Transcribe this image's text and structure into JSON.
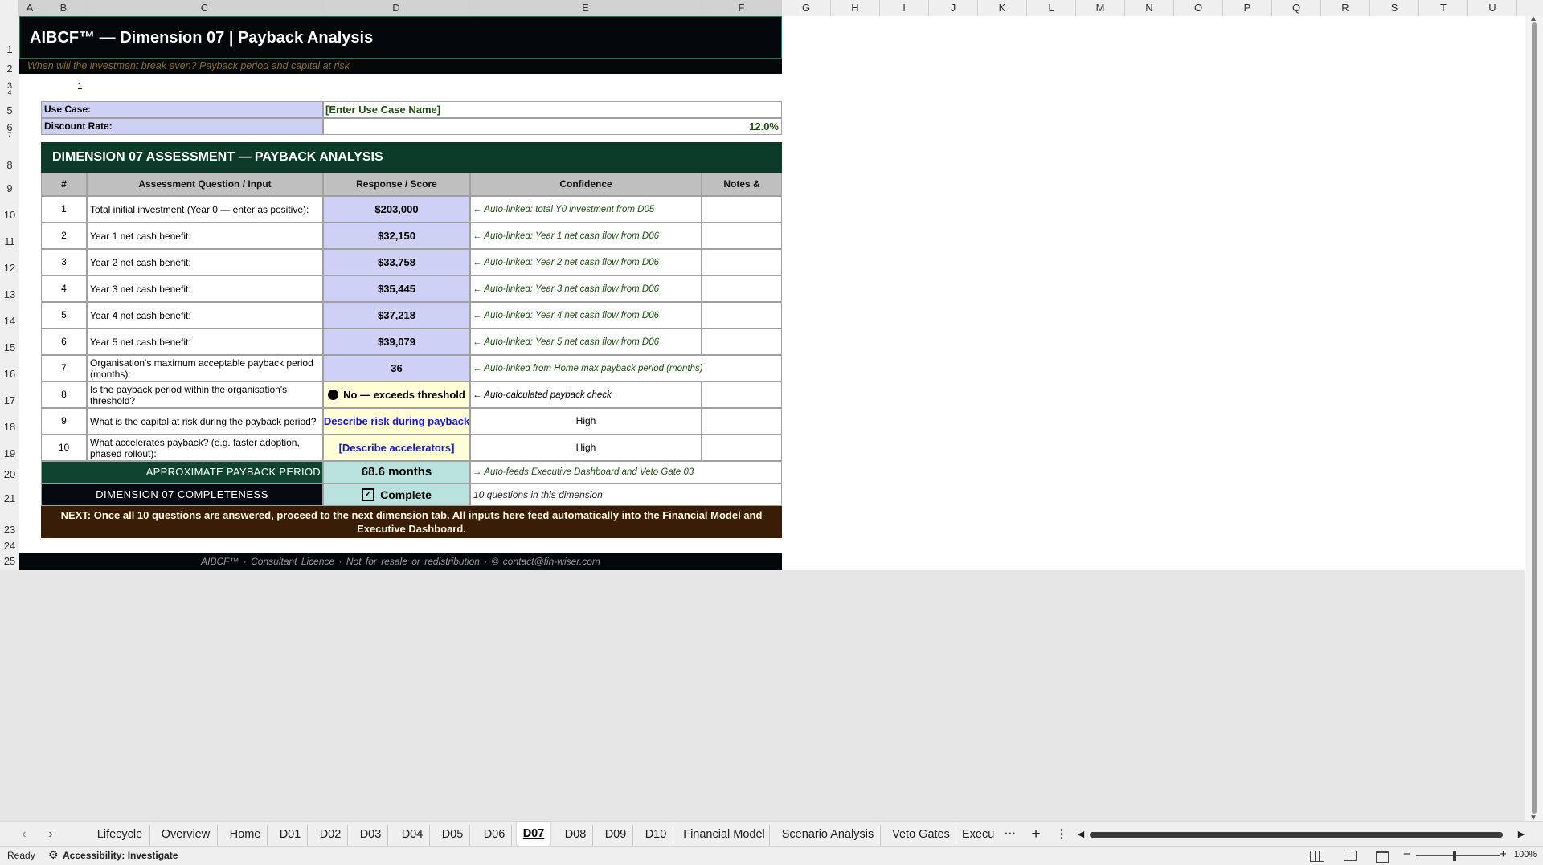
{
  "columns": [
    "A",
    "B",
    "C",
    "D",
    "E",
    "F",
    "G",
    "H",
    "I",
    "J",
    "K",
    "L",
    "M",
    "N",
    "O",
    "P",
    "Q",
    "R",
    "S",
    "T",
    "U"
  ],
  "rows": [
    "1",
    "2",
    "3",
    "4",
    "5",
    "6",
    "7",
    "8",
    "9",
    "10",
    "11",
    "12",
    "13",
    "14",
    "15",
    "16",
    "17",
    "18",
    "19",
    "20",
    "21",
    "23",
    "24",
    "25"
  ],
  "sheet": {
    "title": "AIBCF™ — Dimension 07 | Payback Analysis",
    "subtitle": "When will the investment break even? Payback period and capital at risk",
    "row3_value": "1",
    "use_case_label": "Use Case:",
    "use_case_value": "[Enter Use Case Name]",
    "discount_label": "Discount Rate:",
    "discount_value": "12.0%",
    "section_title": "DIMENSION 07 ASSESSMENT — PAYBACK ANALYSIS",
    "table_headers": [
      "#",
      "Assessment Question / Input",
      "Response / Score",
      "Confidence",
      "Notes & Evidence"
    ],
    "questions": [
      {
        "n": "1",
        "q": "Total initial investment (Year 0 — enter as positive):",
        "r": "$203,000",
        "c": "← Auto-linked: total Y0 investment from D05"
      },
      {
        "n": "2",
        "q": "Year 1 net cash benefit:",
        "r": "$32,150",
        "c": "← Auto-linked: Year 1 net cash flow from D06"
      },
      {
        "n": "3",
        "q": "Year 2 net cash benefit:",
        "r": "$33,758",
        "c": "← Auto-linked: Year 2 net cash flow from D06"
      },
      {
        "n": "4",
        "q": "Year 3 net cash benefit:",
        "r": "$35,445",
        "c": "← Auto-linked: Year 3 net cash flow from D06"
      },
      {
        "n": "5",
        "q": "Year 4 net cash benefit:",
        "r": "$37,218",
        "c": "← Auto-linked: Year 4 net cash flow from D06"
      },
      {
        "n": "6",
        "q": "Year 5 net cash benefit:",
        "r": "$39,079",
        "c": "← Auto-linked: Year 5 net cash flow from D06"
      },
      {
        "n": "7",
        "q": "Organisation's maximum acceptable payback period (months):",
        "r": "36",
        "c": "← Auto-linked from Home max payback period (months)"
      },
      {
        "n": "8",
        "q": "Is the payback period within the organisation's threshold?",
        "r": "No — exceeds threshold",
        "c": "← Auto-calculated payback check"
      },
      {
        "n": "9",
        "q": "What is the capital at risk during the payback period?",
        "r": "Describe risk during payback",
        "c": "High"
      },
      {
        "n": "10",
        "q": "What accelerates payback? (e.g. faster adoption, phased rollout):",
        "r": "[Describe accelerators]",
        "c": "High"
      }
    ],
    "payback_label": "APPROXIMATE PAYBACK PERIOD",
    "payback_value": "68.6 months",
    "payback_note": "→ Auto-feeds Executive Dashboard and Veto Gate 03",
    "completeness_label": "DIMENSION 07 COMPLETENESS",
    "completeness_value": "Complete",
    "completeness_note": "10 questions in this dimension",
    "next_text": "NEXT: Once all 10 questions are answered, proceed to the next dimension tab. All inputs here feed automatically into the Financial Model and Executive Dashboard.",
    "footer": "AIBCF™ · Consultant Licence · Not for resale or redistribution · © contact@fin-wiser.com"
  },
  "tabs": [
    "Lifecycle",
    "Overview",
    "Home",
    "D01",
    "D02",
    "D03",
    "D04",
    "D05",
    "D06",
    "D07",
    "D08",
    "D09",
    "D10",
    "Financial Model",
    "Scenario Analysis",
    "Veto Gates",
    "Execu"
  ],
  "active_tab": "D07",
  "status": {
    "ready": "Ready",
    "accessibility": "Accessibility: Investigate",
    "zoom": "100%"
  },
  "colors": {
    "title_bg": "#04070a",
    "section_bg": "#0d3b2a",
    "input_bg": "#cfd0f6",
    "next_bg": "#3a1d06"
  }
}
